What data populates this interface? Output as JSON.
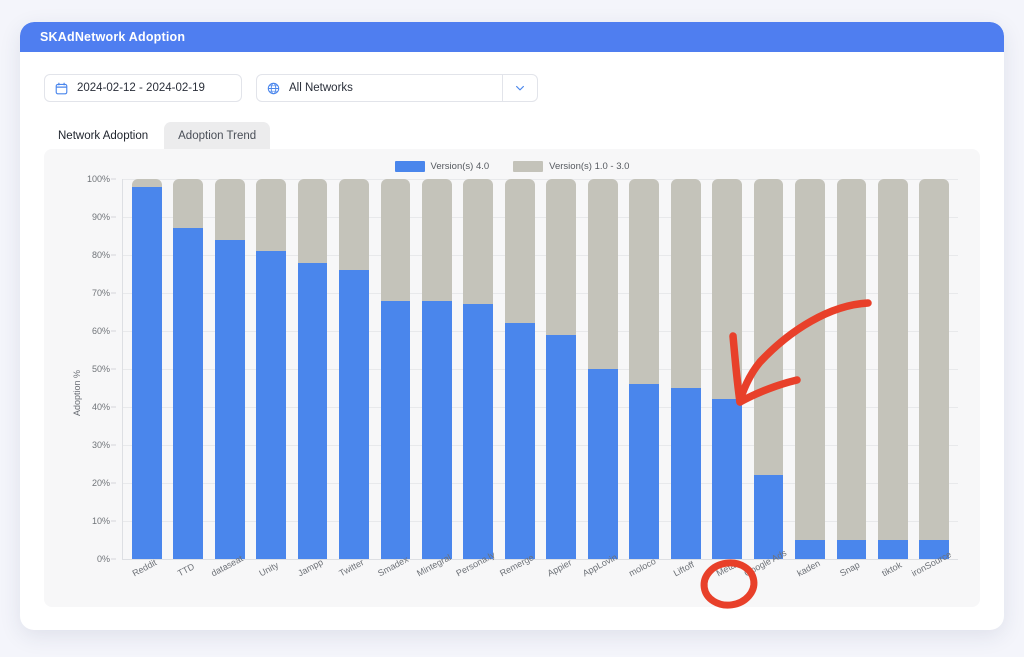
{
  "header": {
    "title": "SKAdNetwork Adoption"
  },
  "controls": {
    "date_range": {
      "value": "2024-02-12 - 2024-02-19",
      "icon": "calendar-icon"
    },
    "network_select": {
      "value": "All Networks",
      "icon": "globe-icon",
      "chevron": "chevron-down-icon"
    }
  },
  "tabs": [
    {
      "label": "Network Adoption",
      "active": true
    },
    {
      "label": "Adoption Trend",
      "active": false
    }
  ],
  "colors": {
    "accent_blue": "#4a86ec",
    "series_gray": "#c4c3ba",
    "header_blue": "#4f7ef0",
    "page_background": "#f4f5fb",
    "panel_background": "#f7f7f8",
    "annotation_red": "#e8402a"
  },
  "annotations": [
    {
      "name": "meta-circle",
      "shape": "ellipse",
      "target": "Meta"
    },
    {
      "name": "meta-arrow",
      "shape": "curved-arrow",
      "target": "Meta bar top"
    }
  ],
  "chart_data": {
    "type": "bar",
    "stacked": true,
    "title": "",
    "xlabel": "",
    "ylabel": "Adoption %",
    "ylim": [
      0,
      100
    ],
    "ytick_labels": [
      "100%",
      "90%",
      "80%",
      "70%",
      "60%",
      "50%",
      "40%",
      "30%",
      "20%",
      "10%",
      "0%"
    ],
    "ytick_values": [
      100,
      90,
      80,
      70,
      60,
      50,
      40,
      30,
      20,
      10,
      0
    ],
    "grid": true,
    "legend_position": "top-center",
    "categories": [
      "Reddit",
      "TTD",
      "dataseat",
      "Unity",
      "Jampp",
      "Twitter",
      "Smadex",
      "Mintegral",
      "Persona.ly",
      "Remerge",
      "Appier",
      "AppLovin",
      "moloco",
      "Liftoff",
      "Meta",
      "Google Ads",
      "kaden",
      "Snap",
      "tiktok",
      "ironSource"
    ],
    "series": [
      {
        "name": "Version(s) 4.0",
        "color": "#4a86ec",
        "values": [
          98,
          87,
          84,
          81,
          78,
          76,
          68,
          68,
          67,
          62,
          59,
          50,
          46,
          45,
          42,
          22,
          5,
          5,
          5,
          5
        ]
      },
      {
        "name": "Version(s) 1.0 - 3.0",
        "color": "#c4c3ba",
        "values": [
          2,
          13,
          16,
          19,
          22,
          24,
          32,
          32,
          33,
          38,
          41,
          50,
          54,
          55,
          58,
          78,
          95,
          95,
          95,
          95
        ]
      }
    ]
  }
}
